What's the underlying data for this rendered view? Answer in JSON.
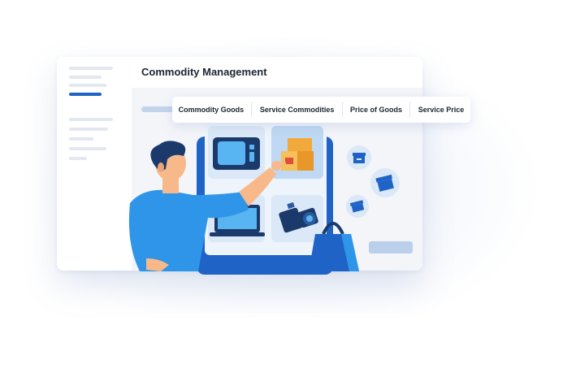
{
  "window": {
    "title": "Commodity Management"
  },
  "tabs": [
    {
      "label": "Commodity Goods"
    },
    {
      "label": "Service Commodities"
    },
    {
      "label": "Price of Goods"
    },
    {
      "label": "Service Price"
    }
  ],
  "colors": {
    "accent": "#1f63c6",
    "primary_blue": "#2f95e8",
    "dark_navy": "#1b3a6b",
    "light_tile": "#e4eefa",
    "orange": "#f2a93b"
  },
  "icons": [
    "monitor-icon",
    "boxes-icon",
    "laptop-icon",
    "camera-icon",
    "archive-box-icon",
    "shopping-bag-icon"
  ]
}
